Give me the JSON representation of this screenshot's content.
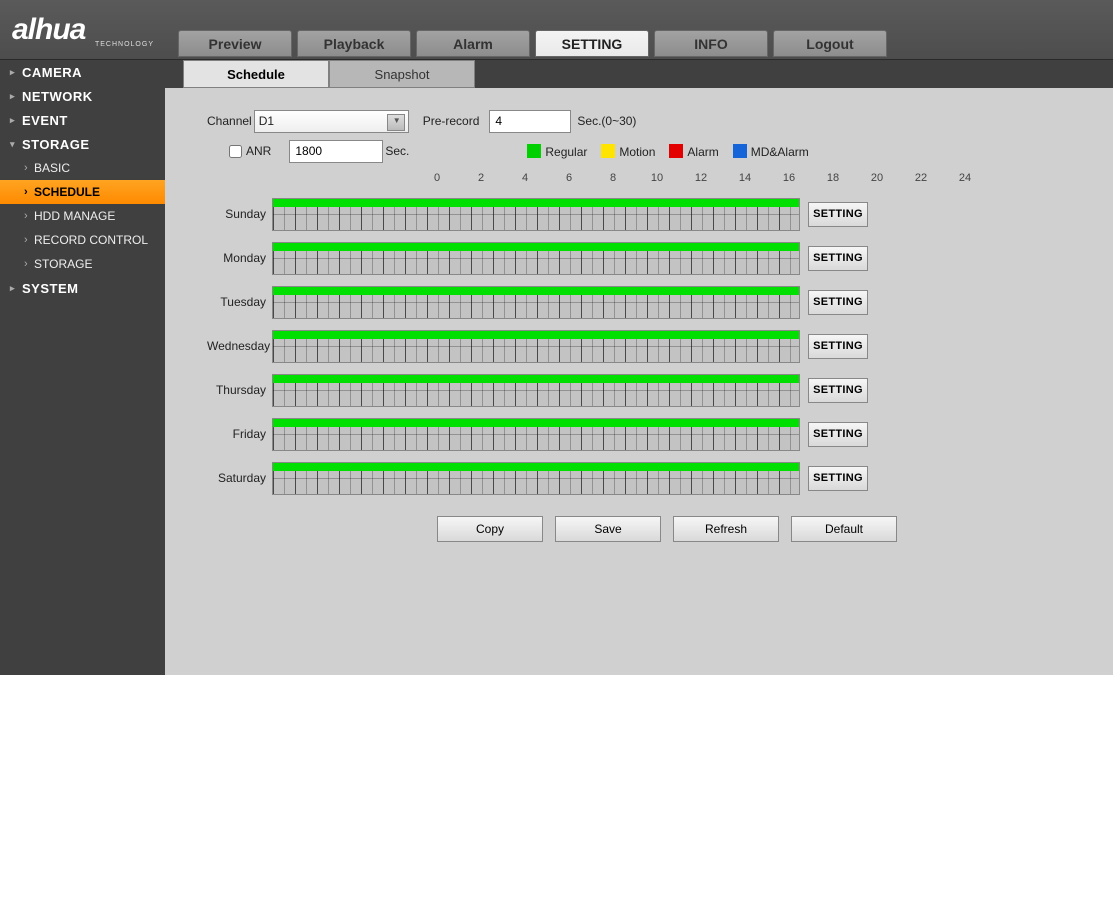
{
  "logo": {
    "brand": "alhua",
    "sub": "TECHNOLOGY"
  },
  "nav": [
    "Preview",
    "Playback",
    "Alarm",
    "SETTING",
    "INFO",
    "Logout"
  ],
  "nav_active": 3,
  "sidebar": [
    {
      "label": "CAMERA",
      "open": false,
      "children": []
    },
    {
      "label": "NETWORK",
      "open": false,
      "children": []
    },
    {
      "label": "EVENT",
      "open": false,
      "children": []
    },
    {
      "label": "STORAGE",
      "open": true,
      "children": [
        "BASIC",
        "SCHEDULE",
        "HDD MANAGE",
        "RECORD CONTROL",
        "STORAGE"
      ],
      "active": 1
    },
    {
      "label": "SYSTEM",
      "open": false,
      "children": []
    }
  ],
  "inner_tabs": {
    "items": [
      "Schedule",
      "Snapshot"
    ],
    "active": 0
  },
  "form": {
    "channel_label": "Channel",
    "channel_value": "D1",
    "prerecord_label": "Pre-record",
    "prerecord_value": "4",
    "prerecord_hint": "Sec.(0~30)",
    "anr_label": "ANR",
    "anr_checked": false,
    "anr_value": "1800",
    "anr_unit": "Sec."
  },
  "legend": [
    {
      "name": "Regular",
      "color": "#00d000"
    },
    {
      "name": "Motion",
      "color": "#ffe400"
    },
    {
      "name": "Alarm",
      "color": "#e20000"
    },
    {
      "name": "MD&Alarm",
      "color": "#1565d8"
    }
  ],
  "hours": [
    "0",
    "2",
    "4",
    "6",
    "8",
    "10",
    "12",
    "14",
    "16",
    "18",
    "20",
    "22",
    "24"
  ],
  "days": [
    "Sunday",
    "Monday",
    "Tuesday",
    "Wednesday",
    "Thursday",
    "Friday",
    "Saturday"
  ],
  "setting_label": "SETTING",
  "buttons": [
    "Copy",
    "Save",
    "Refresh",
    "Default"
  ]
}
